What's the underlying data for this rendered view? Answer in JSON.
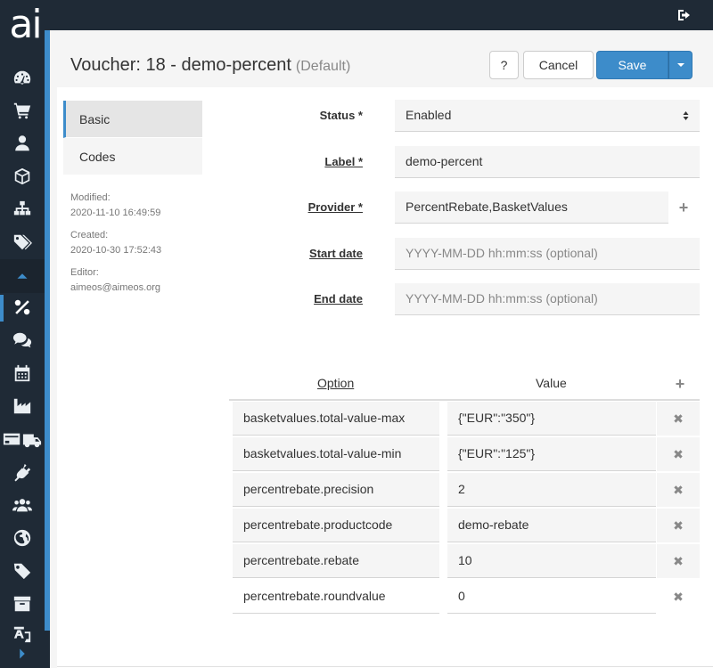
{
  "app": {
    "logo": "ai"
  },
  "nav": {
    "items": [
      {
        "icon": "dashboard-icon"
      },
      {
        "icon": "cart-icon"
      },
      {
        "icon": "user-icon"
      },
      {
        "icon": "box-icon"
      },
      {
        "icon": "sitemap-icon"
      },
      {
        "icon": "tags-icon"
      },
      {
        "icon": "caret-up-icon"
      },
      {
        "icon": "percent-icon",
        "active": true
      },
      {
        "icon": "comments-icon"
      },
      {
        "icon": "calendar-icon"
      },
      {
        "icon": "industry-icon"
      },
      {
        "icon": "payment-delivery-icon"
      },
      {
        "icon": "plug-icon"
      },
      {
        "icon": "users-icon"
      },
      {
        "icon": "globe-icon"
      },
      {
        "icon": "tag-icon"
      },
      {
        "icon": "archive-icon"
      },
      {
        "icon": "language-icon"
      },
      {
        "icon": "caret-right-icon"
      }
    ]
  },
  "header": {
    "title": "Voucher: 18 - demo-percent",
    "site": "(Default)",
    "help_label": "?",
    "cancel_label": "Cancel",
    "save_label": "Save"
  },
  "tabs": [
    {
      "label": "Basic",
      "active": true
    },
    {
      "label": "Codes",
      "active": false
    }
  ],
  "meta": {
    "modified_label": "Modified:",
    "modified_value": "2020-11-10 16:49:59",
    "created_label": "Created:",
    "created_value": "2020-10-30 17:52:43",
    "editor_label": "Editor:",
    "editor_value": "aimeos@aimeos.org"
  },
  "form": {
    "status": {
      "label": "Status *",
      "value": "Enabled"
    },
    "label": {
      "label": "Label *",
      "value": "demo-percent"
    },
    "provider": {
      "label": "Provider *",
      "value": "PercentRebate,BasketValues"
    },
    "start_date": {
      "label": "Start date",
      "placeholder": "YYYY-MM-DD hh:mm:ss (optional)"
    },
    "end_date": {
      "label": "End date",
      "placeholder": "YYYY-MM-DD hh:mm:ss (optional)"
    }
  },
  "options": {
    "header_option": "Option",
    "header_value": "Value",
    "rows": [
      {
        "option": "basketvalues.total-value-max",
        "value": "{\"EUR\":\"350\"}"
      },
      {
        "option": "basketvalues.total-value-min",
        "value": "{\"EUR\":\"125\"}"
      },
      {
        "option": "percentrebate.precision",
        "value": "2"
      },
      {
        "option": "percentrebate.productcode",
        "value": "demo-rebate"
      },
      {
        "option": "percentrebate.rebate",
        "value": "10"
      },
      {
        "option": "percentrebate.roundvalue",
        "value": "0"
      }
    ]
  },
  "colors": {
    "nav_bg": "#1f2a36",
    "accent": "#3d8cca",
    "save_bg": "#3d8cca"
  }
}
